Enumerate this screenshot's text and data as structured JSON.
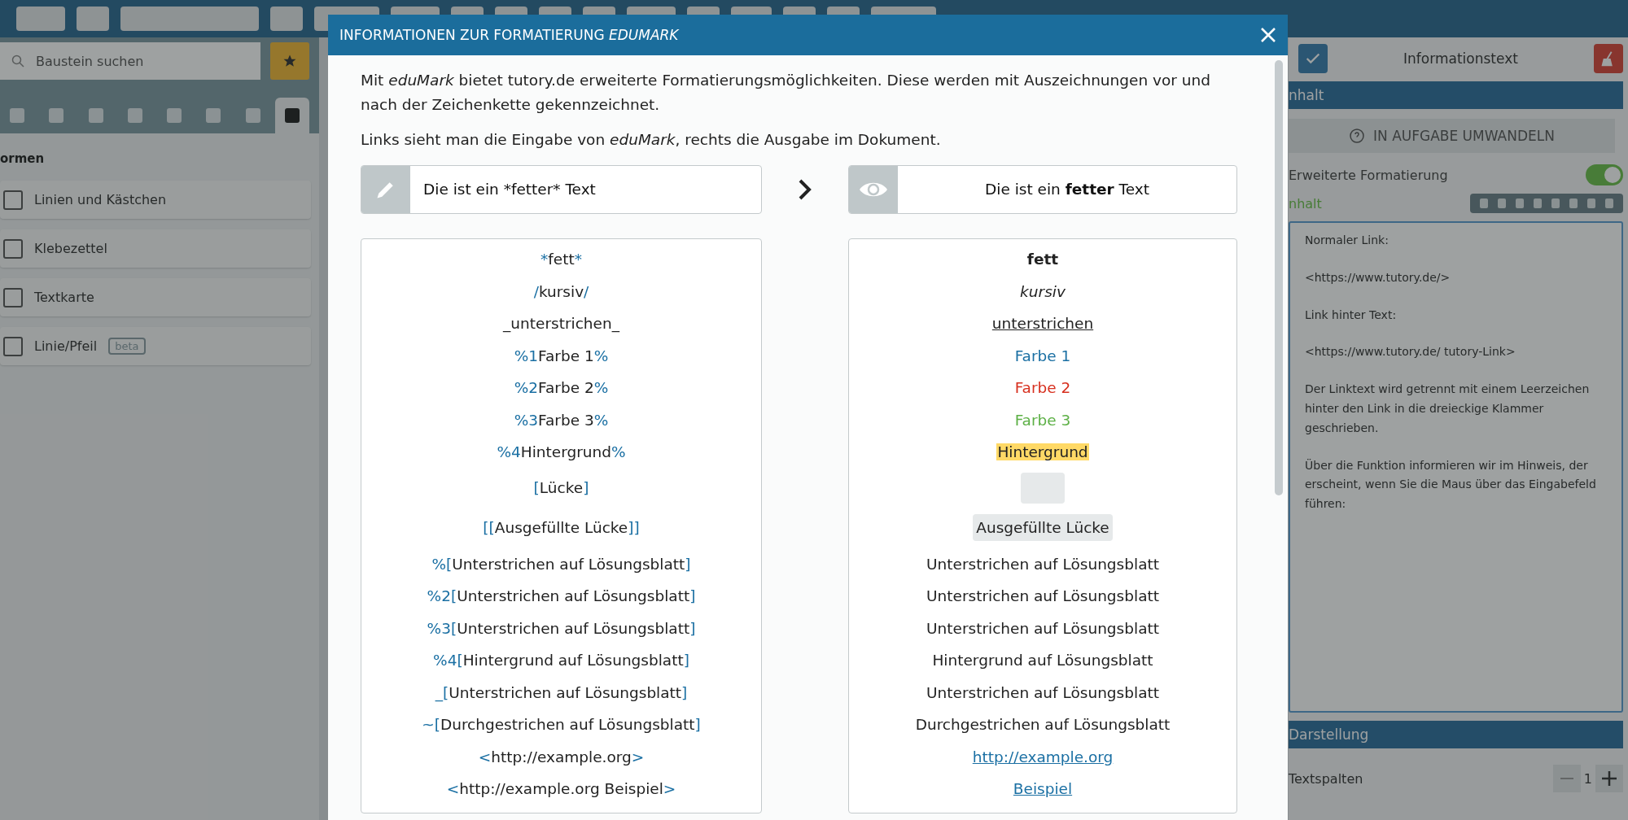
{
  "left_panel": {
    "search": {
      "placeholder": "Baustein suchen"
    },
    "tool_tabs": [
      {
        "selected": false
      },
      {
        "selected": false
      },
      {
        "selected": false
      },
      {
        "selected": false
      },
      {
        "selected": false
      },
      {
        "selected": false
      },
      {
        "selected": false
      },
      {
        "selected": true
      }
    ],
    "section_title": "ormen",
    "items": [
      {
        "label": "Linien und Kästchen"
      },
      {
        "label": "Klebezettel"
      },
      {
        "label": "Textkarte"
      },
      {
        "label": "Linie/Pfeil",
        "badge": "beta"
      }
    ]
  },
  "right_panel": {
    "title": "Informationstext",
    "content_header": "nhalt",
    "convert_button": "IN AUFGABE UMWANDELN",
    "extended_formatting": {
      "label": "Erweiterte Formatierung",
      "on": true
    },
    "field_label": "nhalt",
    "text": [
      "Normaler Link:",
      "<https://www.tutory.de/>",
      "Link hinter Text:",
      "<https://www.tutory.de/ tutory-Link>",
      "Der Linktext wird getrennt mit einem Leerzeichen hinter den Link in die dreieckige Klammer geschrieben.",
      "Über die Funktion informieren wir im Hinweis, der erscheint, wenn Sie die Maus über das Eingabefeld führen:"
    ],
    "display_header": "Darstellung",
    "columns_label": "Textspalten",
    "columns_value": "1"
  },
  "dialog": {
    "title": "INFORMATIONEN ZUR FORMATIERUNG *EDUMARK*",
    "paragraphs": [
      "Mit *eduMark* bietet tutory.de erweiterte Formatierungsmöglichkeiten. Diese werden mit Auszeichnungen vor und nach der Zeichenkette gekennzeichnet.",
      "Links sieht man die Eingabe von *eduMark*, rechts die Ausgabe im Dokument."
    ],
    "example_input": "Die ist ein *fetter* Text",
    "example_output": "Die ist ein **fetter** Text",
    "rows": [
      {
        "input": [
          {
            "kind": "mark",
            "text": "*"
          },
          {
            "kind": "plain",
            "text": "fett"
          },
          {
            "kind": "mark",
            "text": "*"
          }
        ],
        "output": {
          "kind": "bold",
          "text": "fett"
        }
      },
      {
        "input": [
          {
            "kind": "mark",
            "text": "/"
          },
          {
            "kind": "plain",
            "text": "kursiv"
          },
          {
            "kind": "mark",
            "text": "/"
          }
        ],
        "output": {
          "kind": "italic",
          "text": "kursiv"
        }
      },
      {
        "input": [
          {
            "kind": "plain",
            "text": "_unterstrichen_"
          }
        ],
        "output": {
          "kind": "underline",
          "text": "unterstrichen"
        }
      },
      {
        "input": [
          {
            "kind": "mark",
            "text": "%1"
          },
          {
            "kind": "plain",
            "text": "Farbe 1"
          },
          {
            "kind": "mark",
            "text": "%"
          }
        ],
        "output": {
          "kind": "color",
          "color": "#1a6fa3",
          "text": "Farbe 1"
        }
      },
      {
        "input": [
          {
            "kind": "mark",
            "text": "%2"
          },
          {
            "kind": "plain",
            "text": "Farbe 2"
          },
          {
            "kind": "mark",
            "text": "%"
          }
        ],
        "output": {
          "kind": "color",
          "color": "#d7301f",
          "text": "Farbe 2"
        }
      },
      {
        "input": [
          {
            "kind": "mark",
            "text": "%3"
          },
          {
            "kind": "plain",
            "text": "Farbe 3"
          },
          {
            "kind": "mark",
            "text": "%"
          }
        ],
        "output": {
          "kind": "color",
          "color": "#5db046",
          "text": "Farbe 3"
        }
      },
      {
        "input": [
          {
            "kind": "mark",
            "text": "%4"
          },
          {
            "kind": "plain",
            "text": "Hintergrund"
          },
          {
            "kind": "mark",
            "text": "%"
          }
        ],
        "output": {
          "kind": "highlight",
          "text": "Hintergrund"
        }
      },
      {
        "input": [
          {
            "kind": "mark",
            "text": "["
          },
          {
            "kind": "plain",
            "text": "Lücke"
          },
          {
            "kind": "mark",
            "text": "]"
          }
        ],
        "output": {
          "kind": "gap"
        }
      },
      {
        "input": [
          {
            "kind": "mark",
            "text": "[["
          },
          {
            "kind": "plain",
            "text": "Ausgefüllte Lücke"
          },
          {
            "kind": "mark",
            "text": "]]"
          }
        ],
        "output": {
          "kind": "filled",
          "text": "Ausgefüllte Lücke"
        }
      },
      {
        "input": [
          {
            "kind": "mark",
            "text": "%["
          },
          {
            "kind": "plain",
            "text": "Unterstrichen auf Lösungsblatt"
          },
          {
            "kind": "mark",
            "text": "]"
          }
        ],
        "output": {
          "kind": "plain",
          "text": "Unterstrichen auf Lösungsblatt"
        }
      },
      {
        "input": [
          {
            "kind": "mark",
            "text": "%2["
          },
          {
            "kind": "plain",
            "text": "Unterstrichen auf Lösungsblatt"
          },
          {
            "kind": "mark",
            "text": "]"
          }
        ],
        "output": {
          "kind": "plain",
          "text": "Unterstrichen auf Lösungsblatt"
        }
      },
      {
        "input": [
          {
            "kind": "mark",
            "text": "%3["
          },
          {
            "kind": "plain",
            "text": "Unterstrichen auf Lösungsblatt"
          },
          {
            "kind": "mark",
            "text": "]"
          }
        ],
        "output": {
          "kind": "plain",
          "text": "Unterstrichen auf Lösungsblatt"
        }
      },
      {
        "input": [
          {
            "kind": "mark",
            "text": "%4["
          },
          {
            "kind": "plain",
            "text": "Hintergrund auf Lösungsblatt"
          },
          {
            "kind": "mark",
            "text": "]"
          }
        ],
        "output": {
          "kind": "plain",
          "text": "Hintergrund auf Lösungsblatt"
        }
      },
      {
        "input": [
          {
            "kind": "mark",
            "text": "_["
          },
          {
            "kind": "plain",
            "text": "Unterstrichen auf Lösungsblatt"
          },
          {
            "kind": "mark",
            "text": "]"
          }
        ],
        "output": {
          "kind": "plain",
          "text": "Unterstrichen auf Lösungsblatt"
        }
      },
      {
        "input": [
          {
            "kind": "mark",
            "text": "~["
          },
          {
            "kind": "plain",
            "text": "Durchgestrichen auf Lösungsblatt"
          },
          {
            "kind": "mark",
            "text": "]"
          }
        ],
        "output": {
          "kind": "plain",
          "text": "Durchgestrichen auf Lösungsblatt"
        }
      },
      {
        "input": [
          {
            "kind": "mark",
            "text": "<"
          },
          {
            "kind": "plain",
            "text": "http://example.org"
          },
          {
            "kind": "mark",
            "text": ">"
          }
        ],
        "output": {
          "kind": "link",
          "text": "http://example.org"
        }
      },
      {
        "input": [
          {
            "kind": "mark",
            "text": "<"
          },
          {
            "kind": "plain",
            "text": "http://example.org Beispiel"
          },
          {
            "kind": "mark",
            "text": ">"
          }
        ],
        "output": {
          "kind": "link",
          "text": "Beispiel"
        }
      }
    ]
  }
}
